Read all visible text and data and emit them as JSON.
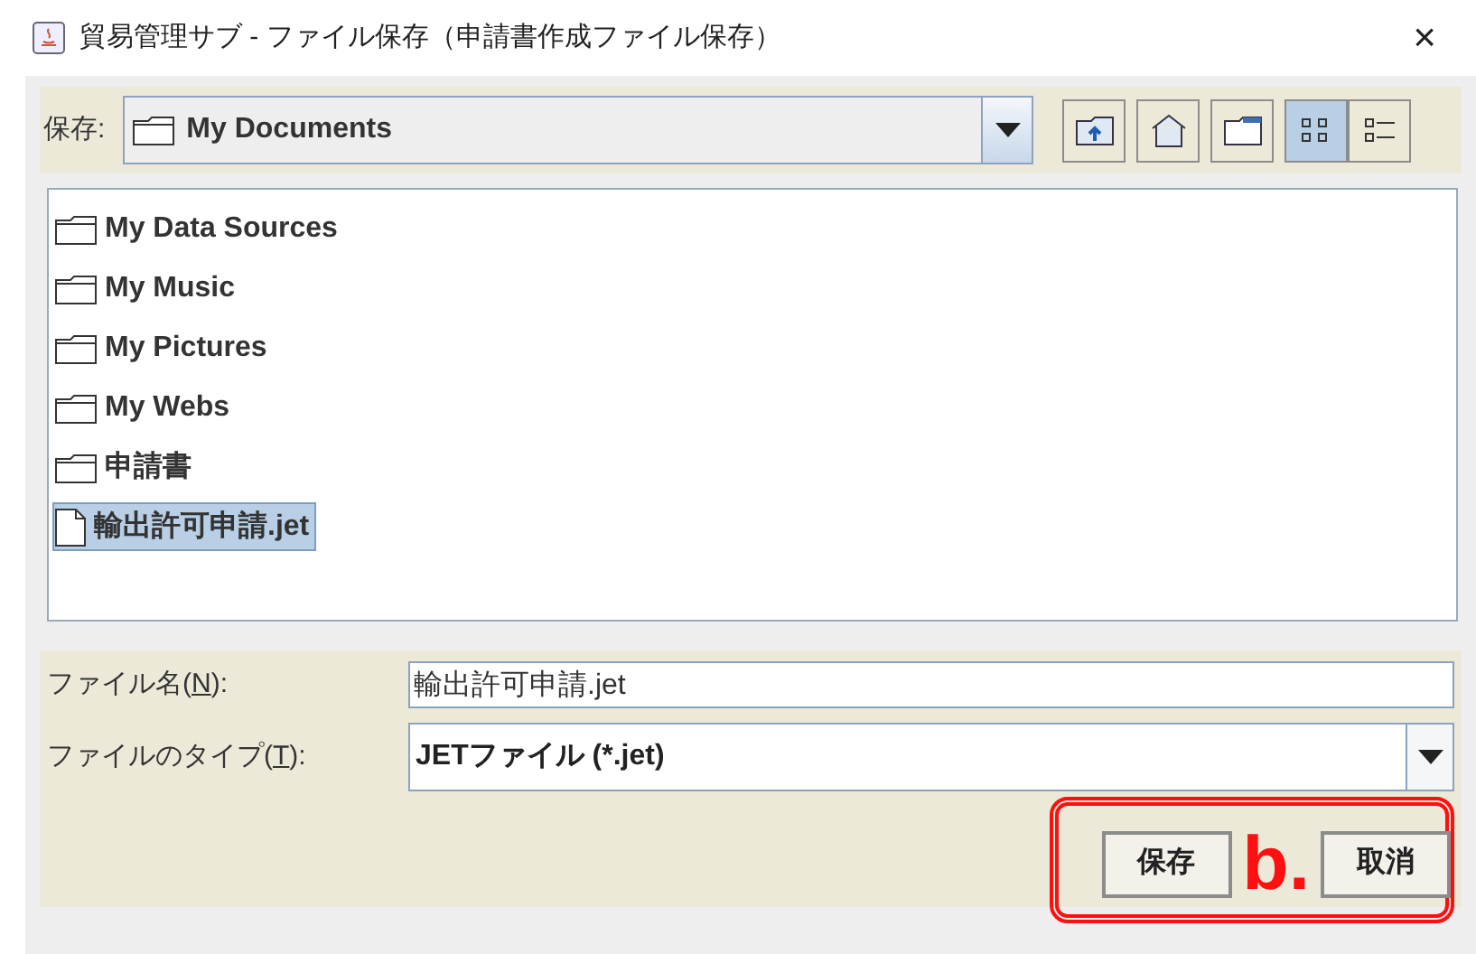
{
  "window": {
    "title": "貿易管理サブ - ファイル保存（申請書作成ファイル保存）",
    "close": "×"
  },
  "save_in": {
    "label": "保存:",
    "value": "My Documents"
  },
  "toolbar": [
    {
      "kind": "up"
    },
    {
      "kind": "home"
    },
    {
      "kind": "new_folder"
    },
    {
      "kind": "list",
      "selected": true
    },
    {
      "kind": "details",
      "selected": false
    }
  ],
  "files": [
    {
      "kind": "folder",
      "name": "My Data Sources",
      "selected": false
    },
    {
      "kind": "folder",
      "name": "My Music",
      "selected": false
    },
    {
      "kind": "folder",
      "name": "My Pictures",
      "selected": false
    },
    {
      "kind": "folder",
      "name": "My Webs",
      "selected": false
    },
    {
      "kind": "folder",
      "name": "申請書",
      "selected": false
    },
    {
      "kind": "file",
      "name": "輸出許可申請.jet",
      "selected": true
    }
  ],
  "file_name": {
    "label": "ファイル名(",
    "mnemonic": "N",
    "label_end": "):",
    "value": "輸出許可申請.jet"
  },
  "file_type": {
    "label": "ファイルのタイプ(",
    "mnemonic": "T",
    "label_end": "):",
    "value": "JETファイル (*.jet)"
  },
  "buttons": [
    "保存",
    "取消"
  ],
  "annotation": {
    "text": "b."
  }
}
